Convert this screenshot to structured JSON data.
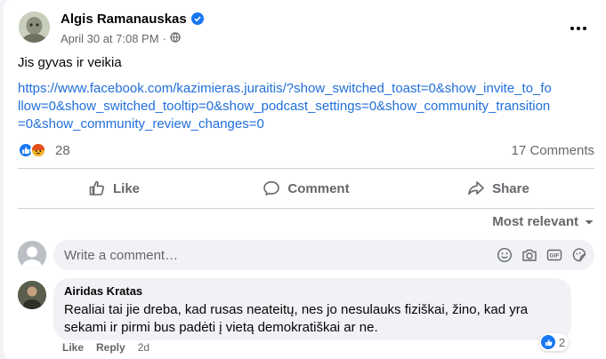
{
  "post": {
    "author": "Algis Ramanauskas",
    "timestamp": "April 30 at 7:08 PM",
    "separator": "·",
    "audience_icon": "globe-icon",
    "text": "Jis gyvas ir veikia",
    "link": "https://www.facebook.com/kazimieras.juraitis/?show_switched_toast=0&show_invite_to_follow=0&show_switched_tooltip=0&show_podcast_settings=0&show_community_transition=0&show_community_review_changes=0"
  },
  "stats": {
    "reactions_count": "28",
    "reaction_icons": [
      "like-icon",
      "angry-icon"
    ],
    "comments": "17 Comments"
  },
  "actions": {
    "like": "Like",
    "comment": "Comment",
    "share": "Share"
  },
  "sort": {
    "label": "Most relevant"
  },
  "composer": {
    "placeholder": "Write a comment…"
  },
  "comment": {
    "author": "Airidas Kratas",
    "text": "Realiai tai jie dreba, kad rusas neateitų, nes jo nesulauks fiziškai, žino, kad yra sekami ir pirmi bus padėti į vietą demokratiškai ar ne.",
    "reactions_count": "2",
    "like": "Like",
    "reply": "Reply",
    "age": "2d"
  },
  "colors": {
    "link": "#216fdb",
    "brand_blue": "#1877f2",
    "secondary_text": "#65676b"
  }
}
